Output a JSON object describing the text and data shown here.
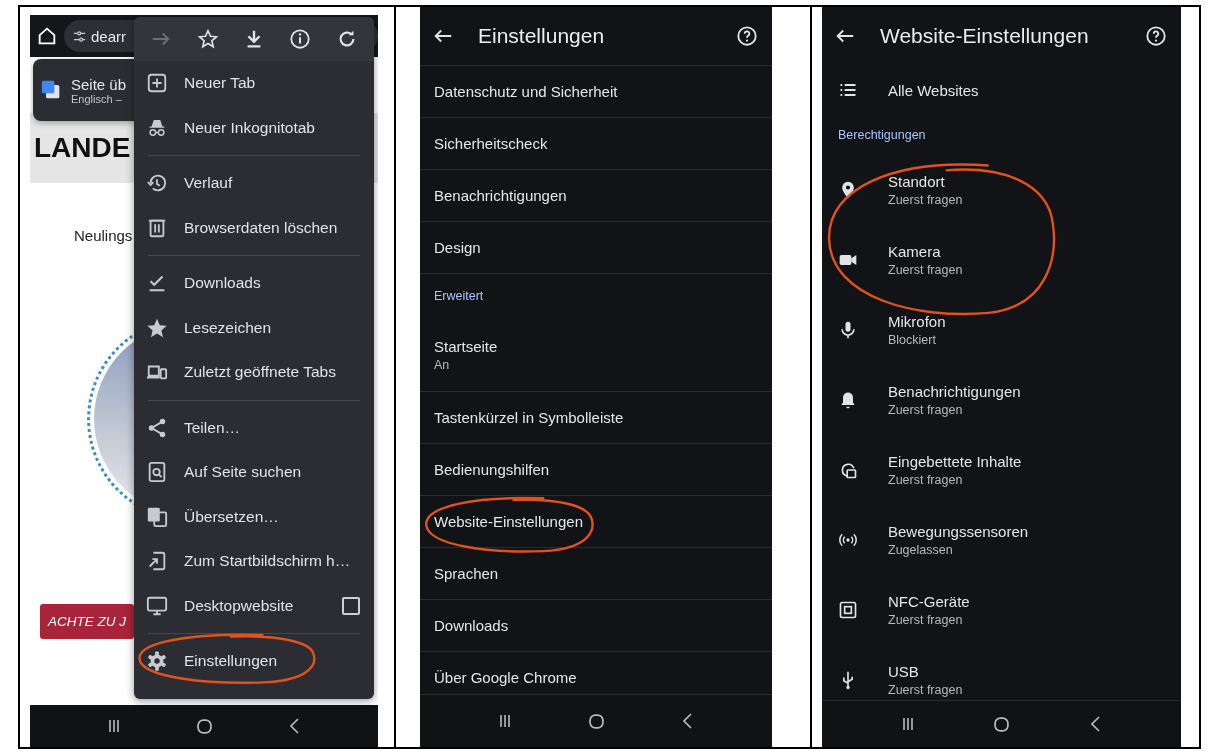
{
  "browser": {
    "address": "dearr",
    "translate_popup": {
      "title": "Seite üb",
      "subtitle": "Englisch –"
    },
    "page": {
      "heading": "LANDE",
      "intro": "Neulings",
      "button": "ACHTE ZU J"
    },
    "menu": {
      "forward_disabled": true,
      "sections": [
        [
          {
            "label": "Neuer Tab",
            "kind": "item",
            "circled": false
          },
          {
            "label": "Neuer Inkognitotab",
            "kind": "item",
            "circled": false
          }
        ],
        [
          {
            "label": "Verlauf",
            "kind": "item",
            "circled": false
          },
          {
            "label": "Browserdaten löschen",
            "kind": "item",
            "circled": false
          }
        ],
        [
          {
            "label": "Downloads",
            "kind": "item",
            "circled": false
          },
          {
            "label": "Lesezeichen",
            "kind": "item",
            "circled": false
          },
          {
            "label": "Zuletzt geöffnete Tabs",
            "kind": "item",
            "circled": false
          }
        ],
        [
          {
            "label": "Teilen…",
            "kind": "item",
            "circled": false
          },
          {
            "label": "Auf Seite suchen",
            "kind": "item",
            "circled": false
          },
          {
            "label": "Übersetzen…",
            "kind": "item",
            "circled": false
          },
          {
            "label": "Zum Startbildschirm h…",
            "kind": "item",
            "circled": false
          },
          {
            "label": "Desktopwebsite",
            "kind": "checkbox",
            "checked": false,
            "circled": false
          }
        ],
        [
          {
            "label": "Einstellungen",
            "kind": "item",
            "circled": true
          }
        ]
      ]
    }
  },
  "settings": {
    "title": "Einstellungen",
    "rows": [
      {
        "kind": "row",
        "label": "Datenschutz und Sicherheit",
        "circled": false
      },
      {
        "kind": "row",
        "label": "Sicherheitscheck",
        "circled": false
      },
      {
        "kind": "row",
        "label": "Benachrichtigungen",
        "circled": false
      },
      {
        "kind": "row",
        "label": "Design",
        "circled": false
      },
      {
        "kind": "section",
        "label": "Erweitert"
      },
      {
        "kind": "row",
        "label": "Startseite",
        "sublabel": "An",
        "circled": false
      },
      {
        "kind": "row",
        "label": "Tastenkürzel in Symbolleiste",
        "circled": false
      },
      {
        "kind": "row",
        "label": "Bedienungshilfen",
        "circled": false
      },
      {
        "kind": "row",
        "label": "Website-Einstellungen",
        "circled": true
      },
      {
        "kind": "row",
        "label": "Sprachen",
        "circled": false
      },
      {
        "kind": "row",
        "label": "Downloads",
        "circled": false
      },
      {
        "kind": "row",
        "label": "Über Google Chrome",
        "circled": false
      }
    ]
  },
  "site_settings": {
    "title": "Website-Einstellungen",
    "all_sites": "Alle Websites",
    "section": "Berechtigungen",
    "permissions": [
      {
        "label": "Standort",
        "status": "Zuerst fragen",
        "circled": true
      },
      {
        "label": "Kamera",
        "status": "Zuerst fragen",
        "circled": true
      },
      {
        "label": "Mikrofon",
        "status": "Blockiert",
        "circled": false
      },
      {
        "label": "Benachrichtigungen",
        "status": "Zuerst fragen",
        "circled": false
      },
      {
        "label": "Eingebettete Inhalte",
        "status": "Zuerst fragen",
        "circled": false
      },
      {
        "label": "Bewegungssensoren",
        "status": "Zugelassen",
        "circled": false
      },
      {
        "label": "NFC-Geräte",
        "status": "Zuerst fragen",
        "circled": false
      },
      {
        "label": "USB",
        "status": "Zuerst fragen",
        "circled": false
      }
    ]
  }
}
